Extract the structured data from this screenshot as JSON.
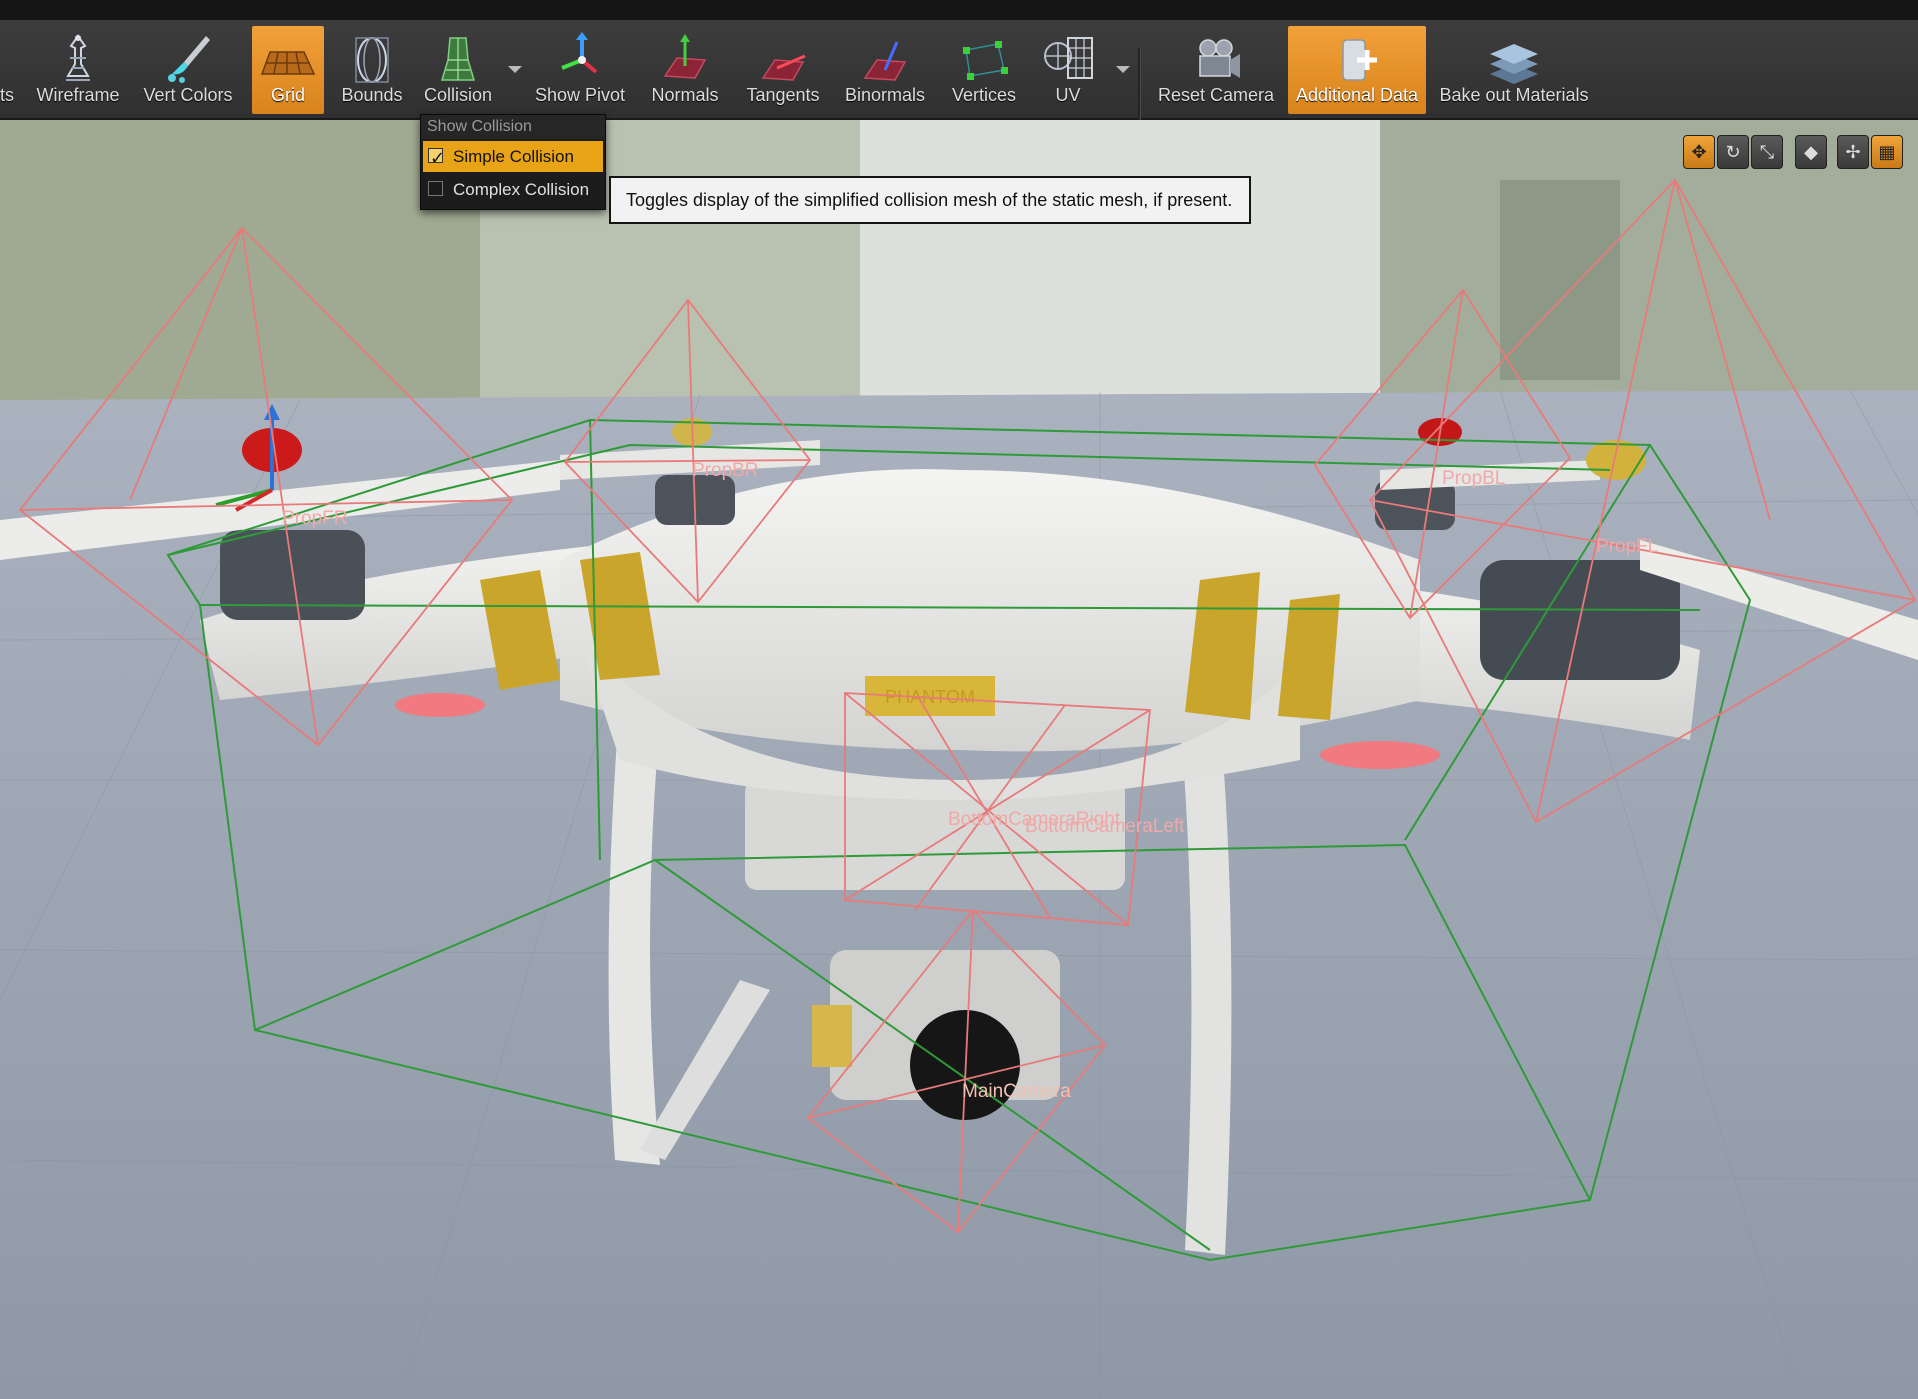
{
  "toolbar": {
    "buttons": [
      {
        "label": "ts"
      },
      {
        "label": "Wireframe"
      },
      {
        "label": "Vert Colors"
      },
      {
        "label": "Grid"
      },
      {
        "label": "Bounds"
      },
      {
        "label": "Collision"
      },
      {
        "label": "Show Pivot"
      },
      {
        "label": "Normals"
      },
      {
        "label": "Tangents"
      },
      {
        "label": "Binormals"
      },
      {
        "label": "Vertices"
      },
      {
        "label": "UV"
      },
      {
        "label": "Reset Camera"
      },
      {
        "label": "Additional Data"
      },
      {
        "label": "Bake out Materials"
      }
    ],
    "active": [
      "Grid",
      "Additional Data"
    ]
  },
  "collision_menu": {
    "header": "Show Collision",
    "items": [
      {
        "label": "Simple Collision",
        "checked": true
      },
      {
        "label": "Complex Collision",
        "checked": false
      }
    ]
  },
  "tooltip": {
    "text": "Toggles display of the simplified collision mesh of the static mesh, if present."
  },
  "viewport_tools": {
    "icons": [
      "translate-icon",
      "rotate-icon",
      "scale-icon",
      "local-space-icon",
      "surface-snap-icon",
      "grid-snap-icon"
    ]
  },
  "scene_labels": {
    "prop_fr": "PropFR",
    "prop_br": "PropBR",
    "prop_bl": "PropBL",
    "prop_fl": "PropFL",
    "bottom_camera_right": "BottomCameraRight",
    "bottom_camera_left": "BottomCameraLeft",
    "main_camera": "MainCamera",
    "body_text": "PHANTOM"
  },
  "colors": {
    "accent": "#e8a416",
    "collision_wire": "#e87a7a",
    "bounds_wire": "#2f9a38"
  }
}
